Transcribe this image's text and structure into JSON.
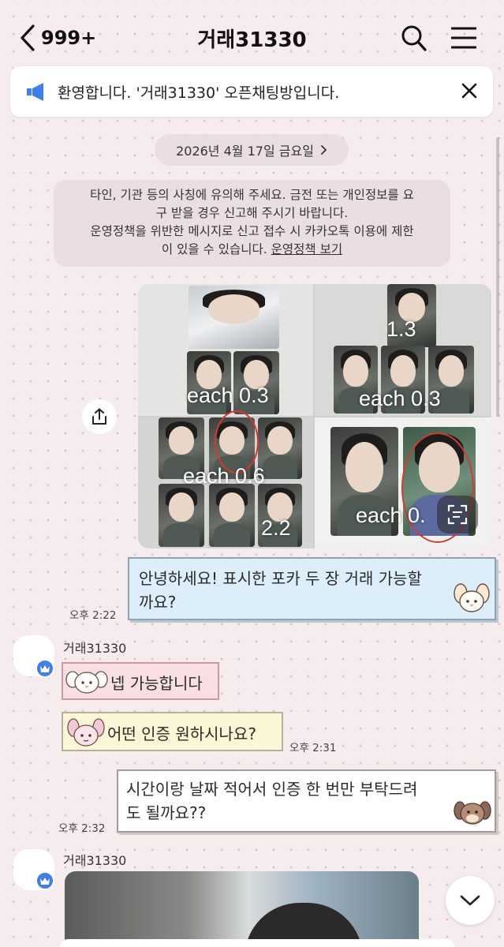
{
  "header": {
    "back_count": "999+",
    "title": "거래31330",
    "search_icon": "search-icon",
    "menu_icon": "hamburger-menu-icon"
  },
  "notice": {
    "text": "환영합니다. '거래31330' 오픈채팅방입니다."
  },
  "date_divider": {
    "label": "2026년 4월 17일 금요일"
  },
  "system_message": {
    "line1": "타인, 기관 등의 사칭에 유의해 주세요. 금전 또는 개인정보를 요",
    "line2": "구 받을 경우 신고해 주시기 바랍니다.",
    "line3": "운영정책을 위반한 메시지로 신고 접수 시 카카오톡 이용에 제한",
    "line4_prefix": "이 있을 수 있습니다. ",
    "line4_link": "운영정책 보기"
  },
  "photo_message": {
    "price_labels": [
      "1.3",
      "each 0.3",
      "each 0.3",
      "each 0.6",
      "2.2",
      "each 0."
    ]
  },
  "messages": [
    {
      "from": "me",
      "text_line1": "안녕하세요! 표시한 포카 두 장 거래 가능할",
      "text_line2": "까요?",
      "time": "오후 2:22"
    },
    {
      "from": "other",
      "sender": "거래31330",
      "text": "넵 가능합니다"
    },
    {
      "from": "other",
      "text": "어떤 인증 원하시나요?",
      "time": "오후 2:31"
    },
    {
      "from": "me",
      "text_line1": "시간이랑 날짜 적어서 인증 한 번만 부탁드려",
      "text_line2": "도 될까요??",
      "time": "오후 2:32"
    },
    {
      "from": "other",
      "sender": "거래31330",
      "type": "photo"
    }
  ],
  "colors": {
    "background": "#f6ecee",
    "crown_badge": "#3d7ef0",
    "notice_icon": "#3d7ef0",
    "bubble_blue": "#dceefa",
    "bubble_pink": "#f9dfe4",
    "bubble_cream": "#fbf6d6"
  }
}
